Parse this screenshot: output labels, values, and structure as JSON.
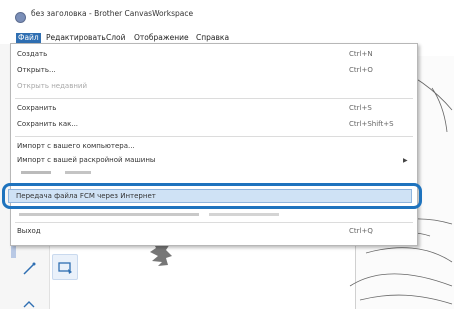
{
  "window": {
    "title": "без заголовка - Brother CanvasWorkspace"
  },
  "menubar": {
    "items": [
      {
        "id": "file",
        "label": "Файл"
      },
      {
        "id": "edit",
        "label": "Редактировать"
      },
      {
        "id": "layer",
        "label": "Слой"
      },
      {
        "id": "view",
        "label": "Отображение"
      },
      {
        "id": "help",
        "label": "Справка"
      }
    ]
  },
  "file_menu": {
    "new": {
      "label": "Создать",
      "shortcut": "Ctrl+N"
    },
    "open": {
      "label": "Открыть...",
      "shortcut": "Ctrl+O"
    },
    "open_recent": {
      "label": "Открыть недавний"
    },
    "save": {
      "label": "Сохранить",
      "shortcut": "Ctrl+S"
    },
    "save_as": {
      "label": "Сохранить как...",
      "shortcut": "Ctrl+Shift+S"
    },
    "import_pc": {
      "label": "Импорт с вашего компьютера..."
    },
    "import_machine": {
      "label": "Импорт с вашей раскройной машины"
    },
    "transfer_fcm": {
      "label": "Передача файла FCM через Интернет"
    },
    "exit": {
      "label": "Выход",
      "shortcut": "Ctrl+Q"
    }
  },
  "colors": {
    "accent": "#1e73be",
    "menu_active_bg": "#2f6fb2",
    "highlight_bg": "#cfe2f5"
  }
}
